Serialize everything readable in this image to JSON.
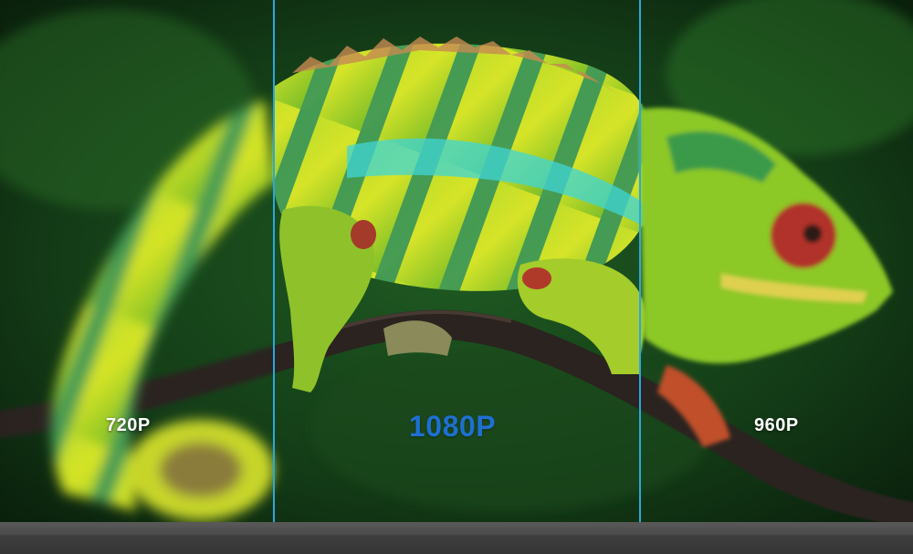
{
  "labels": {
    "left": "720P",
    "center": "1080P",
    "right": "960P"
  },
  "colors": {
    "divider": "#29a8e0",
    "center_label": "#1e6fd0",
    "side_label": "#ffffff",
    "background_green": "#0f2a12",
    "lizard_green": "#8fd12a",
    "lizard_yellow": "#d8e22a",
    "lizard_teal": "#2aa49a",
    "eye_red": "#b0322a"
  },
  "icons": [
    "chameleon-image",
    "branch-image"
  ]
}
